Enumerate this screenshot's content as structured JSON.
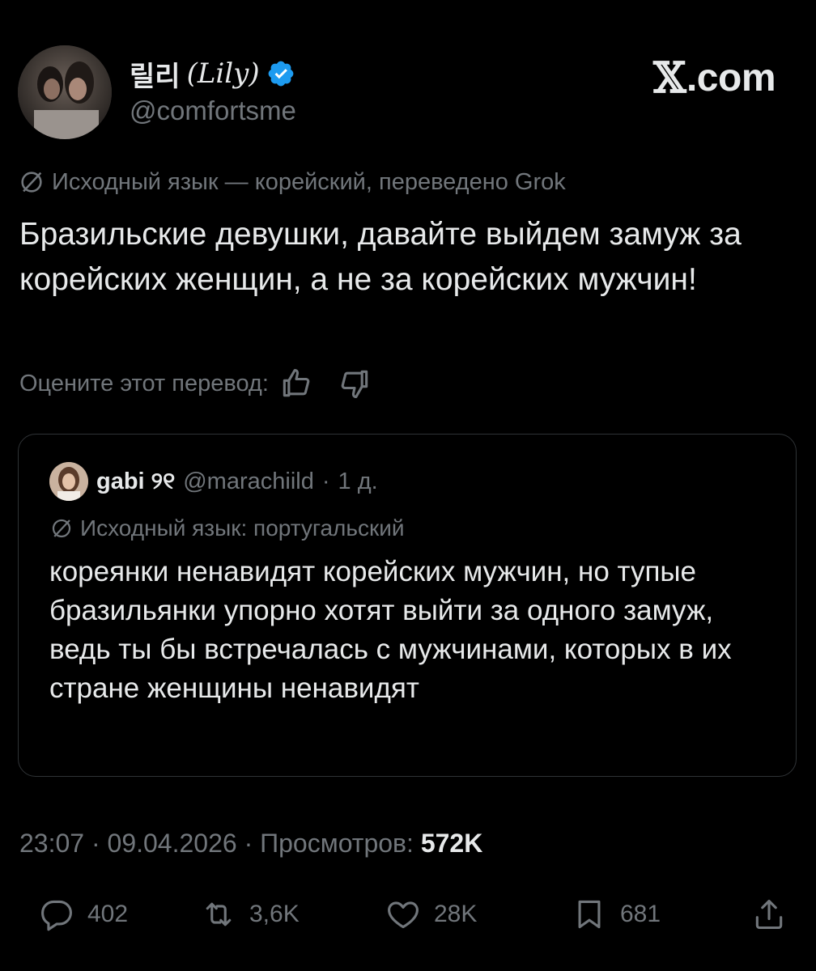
{
  "author": {
    "display_name": "릴리",
    "display_name_latin": "(Lily)",
    "handle": "@comfortsme",
    "verified": true
  },
  "brand": {
    "logo_letter": "𝕏",
    "suffix": ".com"
  },
  "translation_note": "Исходный язык — корейский, переведено Grok",
  "tweet_text": "Бразильские девушки, давайте выйдем замуж за корейских женщин, а не за корейских мужчин!",
  "rate_translation_label": "Оцените этот перевод:",
  "quote": {
    "name": "gabi ୨୧",
    "handle": "@marachiild",
    "separator": "·",
    "time": "1 д.",
    "note": "Исходный язык: португальский",
    "text": "кореянки ненавидят корейских мужчин, но тупые бразильянки упорно хотят выйти за одного замуж, ведь ты бы встречалась с мужчинами, которых в их стране женщины ненавидят"
  },
  "meta": {
    "time": "23:07",
    "date": "09.04.2026",
    "views_label": "Просмотров:",
    "views": "572K",
    "separator": "·"
  },
  "actions": {
    "replies": "402",
    "reposts": "3,6K",
    "likes": "28K",
    "bookmarks": "681"
  },
  "colors": {
    "background": "#000000",
    "text": "#e7e9ea",
    "muted": "#71767b",
    "verified": "#1d9bf0",
    "border": "#2f3336"
  }
}
